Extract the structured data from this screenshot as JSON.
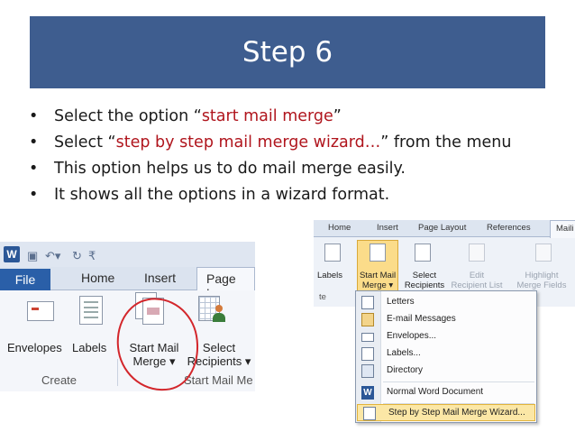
{
  "slide": {
    "title": "Step 6",
    "bullets": [
      {
        "before": "Select the option “",
        "highlight": "start mail merge",
        "after": "”"
      },
      {
        "before": "Select “",
        "highlight": "step by step mail merge wizard…",
        "after": "” from the menu"
      },
      {
        "before": "This option helps us to do mail merge easily.",
        "highlight": "",
        "after": ""
      },
      {
        "before": "It shows all the options in a wizard format.",
        "highlight": "",
        "after": ""
      }
    ]
  },
  "ribbon_left": {
    "file_tab": "File",
    "tabs": [
      "Home",
      "Insert",
      "Page Lay"
    ],
    "envelopes": "Envelopes",
    "labels": "Labels",
    "start_mail": "Start Mail",
    "merge": "Merge ▾",
    "select": "Select",
    "recipients": "Recipients ▾",
    "group_create": "Create",
    "group_start": "Start Mail Me"
  },
  "ribbon_right": {
    "tabs": [
      "Home",
      "Insert",
      "Page Layout",
      "References",
      "Maili"
    ],
    "labels": "Labels",
    "start_mail": "Start Mail",
    "merge": "Merge ▾",
    "select": "Select",
    "recipients": "Recipients ▾",
    "edit": "Edit",
    "recipient_list": "Recipient List",
    "highlight": "Highlight",
    "merge_fields": "Merge Fields",
    "group_fragment": "te"
  },
  "dropdown": {
    "items": [
      {
        "label": "Letters",
        "icon": "document-icon"
      },
      {
        "label": "E-mail Messages",
        "icon": "email-icon"
      },
      {
        "label": "Envelopes...",
        "icon": "envelope-icon"
      },
      {
        "label": "Labels...",
        "icon": "labels-icon"
      },
      {
        "label": "Directory",
        "icon": "directory-icon"
      },
      {
        "label": "Normal Word Document",
        "icon": "word-icon"
      },
      {
        "label": "Step by Step Mail Merge Wizard...",
        "icon": "wizard-icon"
      }
    ]
  },
  "colors": {
    "title_bg": "#3e5d8f",
    "highlight_text": "#b0151d",
    "annotation_circle": "#d3262b"
  }
}
